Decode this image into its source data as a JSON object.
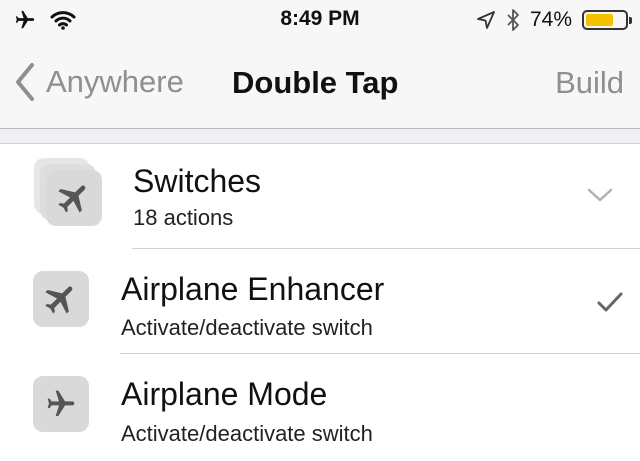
{
  "status_bar": {
    "time": "8:49 PM",
    "battery_percent": "74%",
    "battery_level": 0.74,
    "battery_color": "#f5c000",
    "left_icons": [
      "airplane-icon",
      "wifi-icon"
    ],
    "right_icons": [
      "location-icon",
      "bluetooth-icon",
      "battery-icon"
    ]
  },
  "navbar": {
    "back_label": "Anywhere",
    "title": "Double Tap",
    "action_label": "Build"
  },
  "list": {
    "items": [
      {
        "title": "Switches",
        "subtitle": "18 actions",
        "icon": "airplane-icon",
        "accessory": "chevron-down-icon"
      },
      {
        "title": "Airplane Enhancer",
        "subtitle": "Activate/deactivate switch",
        "icon": "airplane-icon",
        "accessory": "checkmark-icon"
      },
      {
        "title": "Airplane Mode",
        "subtitle": "Activate/deactivate switch",
        "icon": "airplane-small-icon",
        "accessory": ""
      }
    ]
  }
}
